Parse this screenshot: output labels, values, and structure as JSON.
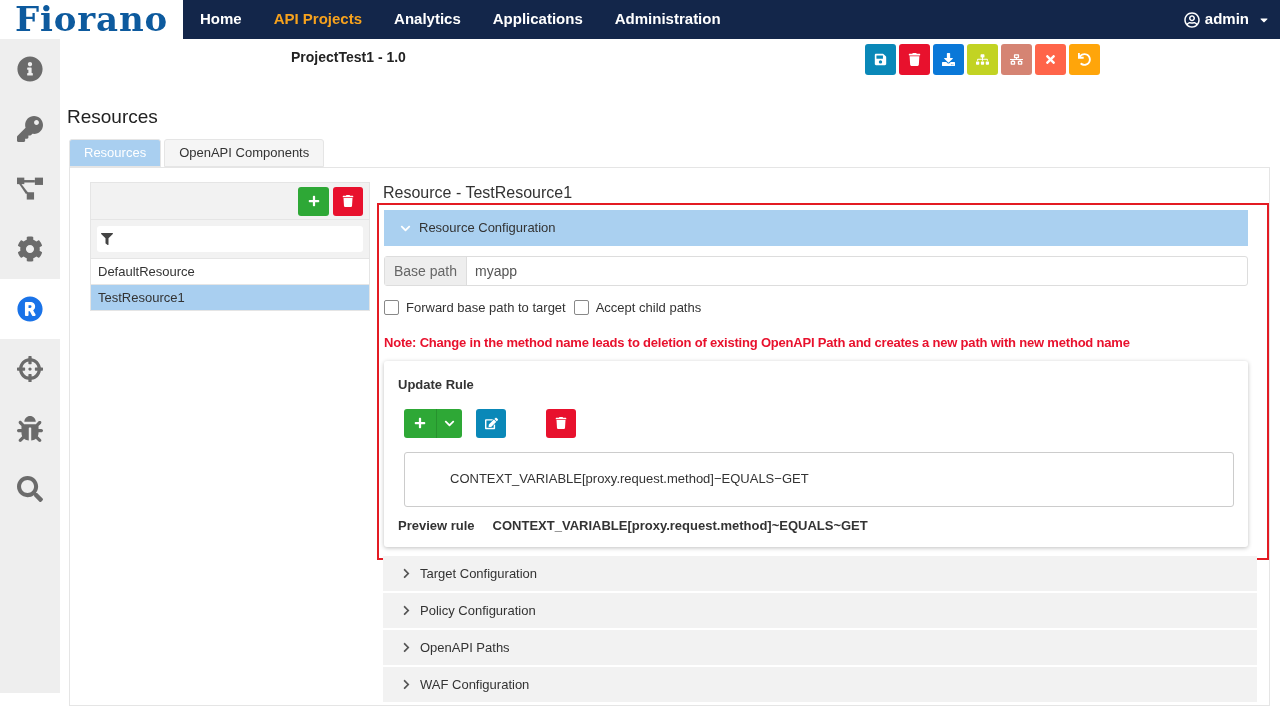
{
  "logo": {
    "text": "Fiorano"
  },
  "nav": [
    {
      "label": "Home",
      "selected": false
    },
    {
      "label": "API Projects",
      "selected": true
    },
    {
      "label": "Analytics",
      "selected": false
    },
    {
      "label": "Applications",
      "selected": false
    },
    {
      "label": "Administration",
      "selected": false
    }
  ],
  "user": {
    "name": "admin"
  },
  "sidebar": [
    {
      "kind": "info",
      "selected": false
    },
    {
      "kind": "key",
      "selected": false
    },
    {
      "kind": "flow",
      "selected": false
    },
    {
      "kind": "settings",
      "selected": false
    },
    {
      "kind": "registered",
      "selected": true
    },
    {
      "kind": "target",
      "selected": false
    },
    {
      "kind": "bug",
      "selected": false
    },
    {
      "kind": "search",
      "selected": false
    }
  ],
  "project_title": "ProjectTest1 - 1.0",
  "toolbar": [
    {
      "kind": "save",
      "color": "#0a88b8"
    },
    {
      "kind": "delete",
      "color": "#e8112d"
    },
    {
      "kind": "download",
      "color": "#0a78d8"
    },
    {
      "kind": "hierarchy",
      "color": "#c2d323"
    },
    {
      "kind": "network",
      "color": "#d58473"
    },
    {
      "kind": "close",
      "color": "#ff654a"
    },
    {
      "kind": "undo",
      "color": "#ffa50a"
    }
  ],
  "heading": "Resources",
  "tabs": [
    {
      "label": "Resources",
      "selected": true
    },
    {
      "label": "OpenAPI Components",
      "selected": false
    }
  ],
  "resource_list": {
    "items": [
      {
        "label": "DefaultResource",
        "selected": false
      },
      {
        "label": "TestResource1",
        "selected": true
      }
    ]
  },
  "resource_title": "Resource - TestResource1",
  "config": {
    "title": "Resource Configuration",
    "expanded": true,
    "highlighted": true,
    "base_path_label": "Base path",
    "base_path_value": "myapp",
    "checkboxes": [
      {
        "label": "Forward base path to target",
        "checked": false
      },
      {
        "label": "Accept child paths",
        "checked": false
      }
    ],
    "note": "Note: Change in the method name leads to deletion of existing OpenAPI Path and creates a new path with new method name",
    "update_rule": {
      "title": "Update Rule",
      "rule": "CONTEXT_VARIABLE[proxy.request.method]−EQUALS−GET",
      "preview_label": "Preview rule",
      "preview": "CONTEXT_VARIABLE[proxy.request.method]~EQUALS~GET"
    }
  },
  "sections": [
    {
      "title": "Target Configuration",
      "expanded": false
    },
    {
      "title": "Policy Configuration",
      "expanded": false
    },
    {
      "title": "OpenAPI Paths",
      "expanded": false
    },
    {
      "title": "WAF Configuration",
      "expanded": false
    }
  ]
}
